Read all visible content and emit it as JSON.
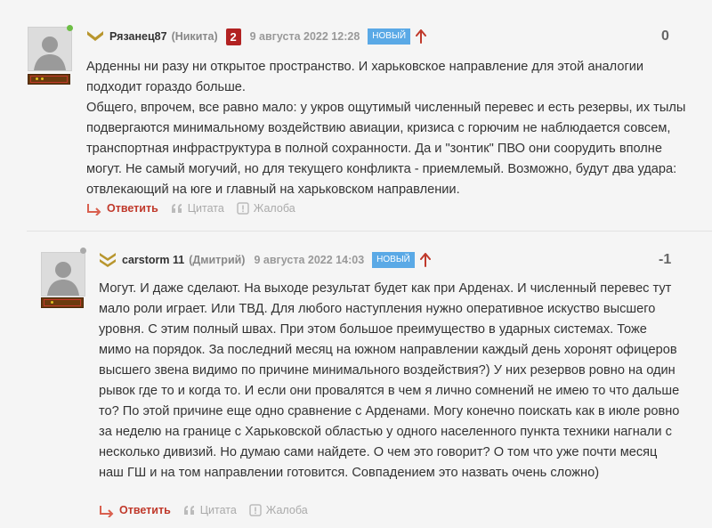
{
  "comments": [
    {
      "username": "Рязанец87",
      "realname": "(Никита)",
      "badge": "2",
      "date": "9 августа 2022 12:28",
      "new_label": "НОВЫЙ",
      "score": "0",
      "paragraphs": [
        "Арденны ни разу ни открытое пространство. И харьковское направление для этой аналогии подходит гораздо больше.",
        "Общего, впрочем, все равно мало: у укров ощутимый численный перевес и есть резервы, их тылы подвергаются минимальному воздействию авиации, кризиса с горючим не наблюдается совсем, транспортная инфраструктура в полной сохранности. Да и \"зонтик\" ПВО они соорудить вполне могут. Не самый могучий, но для текущего конфликта - приемлемый. Возможно, будут два удара: отвлекающий на юге и главный на харьковском направлении."
      ],
      "online_color": "#6dbe45"
    },
    {
      "username": "carstorm 11",
      "realname": "(Дмитрий)",
      "date": "9 августа 2022 14:03",
      "new_label": "НОВЫЙ",
      "score": "-1",
      "paragraphs": [
        "Могут. И даже сделают. На выходе результат будет как при Арденах. И численный перевес тут мало роли играет. Или ТВД. Для любого наступления нужно оперативное искуство высшего уровня. С этим полный швах. При этом большое преимущество в ударных системах. Тоже мимо на порядок. За последний месяц на южном направлении каждый день хоронят офицеров высшего звена видимо по причине минимального воздействия?) У них резервов ровно на один рывок где то и когда то. И если они провалятся в чем я лично сомнений не имею то что дальше то? По этой причине еще одно сравнение с Арденами. Могу конечно поискать как в июле ровно за неделю на границе с Харьковской областью у одного населенного пункта техники нагнали с несколько дивизий. Но думаю сами найдете. О чем это говорит? О том что уже почти месяц наш ГШ и на том направлении готовится. Совпадением это назвать очень сложно)"
      ],
      "online_color": "#aaaaaa"
    }
  ],
  "actions": {
    "reply": "Ответить",
    "quote": "Цитата",
    "report": "Жалоба"
  },
  "icons": {
    "reply": "reply-arrow-icon",
    "quote": "quote-icon",
    "report": "report-icon",
    "vote": "vote-up-arrow-icon"
  },
  "colors": {
    "accent_red": "#c0392b",
    "new_badge": "#5aa9e6",
    "rank_badge": "#b22222"
  }
}
